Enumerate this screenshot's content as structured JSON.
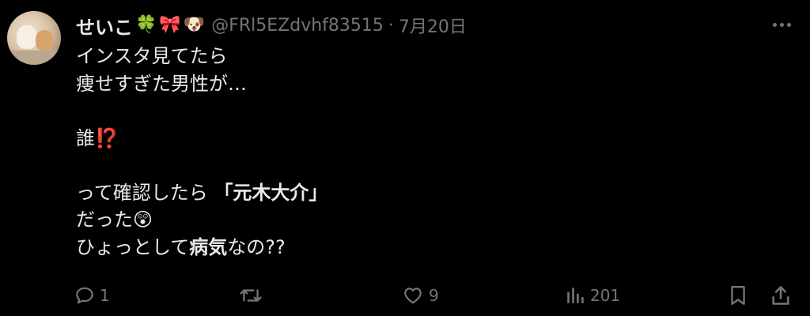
{
  "author": {
    "display_name": "せいこ",
    "name_emojis": [
      "🍀",
      "🎀",
      "🐶"
    ],
    "handle": "@FRl5EZdvhf83515",
    "separator": "·",
    "date": "7月20日"
  },
  "body_lines": [
    [
      {
        "text": "インスタ見てたら"
      }
    ],
    [
      {
        "text": "痩せすぎた男性が…"
      }
    ],
    [],
    [
      {
        "text": "誰"
      },
      {
        "text": "⁉️",
        "style": "red"
      }
    ],
    [],
    [
      {
        "text": "って確認したら "
      },
      {
        "text": "「元木大介」",
        "style": "bold"
      }
    ],
    [
      {
        "text": "だった"
      },
      {
        "text": "😲"
      }
    ],
    [
      {
        "text": "ひょっとして"
      },
      {
        "text": "病気",
        "style": "bold"
      },
      {
        "text": "なの??"
      }
    ]
  ],
  "actions": {
    "reply_count": "1",
    "retweet_count": "",
    "like_count": "9",
    "view_count": "201"
  },
  "colors": {
    "background": "#000000",
    "text": "#e7e9ea",
    "muted": "#71767b"
  },
  "icons": [
    "more-icon",
    "reply-icon",
    "retweet-icon",
    "like-icon",
    "views-icon",
    "bookmark-icon",
    "share-icon"
  ]
}
